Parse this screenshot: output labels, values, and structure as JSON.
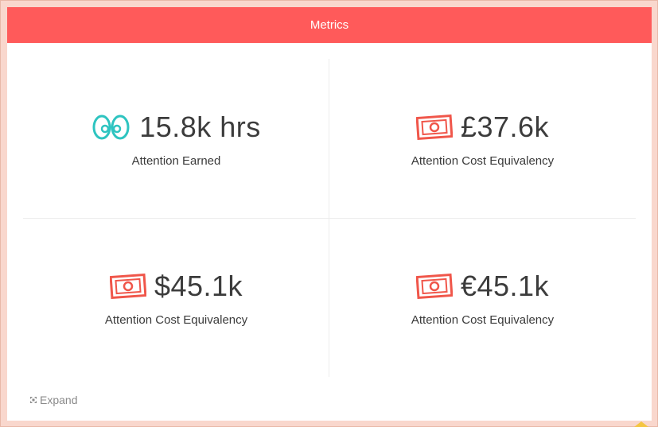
{
  "header": {
    "title": "Metrics"
  },
  "colors": {
    "accent": "#ff5a5a",
    "eyes": "#2ec4c0",
    "money": "#f0564a"
  },
  "metrics": [
    {
      "icon": "eyes-icon",
      "value": "15.8k hrs",
      "label": "Attention Earned"
    },
    {
      "icon": "money-icon",
      "value": "£37.6k",
      "label": "Attention Cost Equivalency"
    },
    {
      "icon": "money-icon",
      "value": "$45.1k",
      "label": "Attention Cost Equivalency"
    },
    {
      "icon": "money-icon",
      "value": "€45.1k",
      "label": "Attention Cost Equivalency"
    }
  ],
  "footer": {
    "expand_label": "Expand",
    "expand_icon": "expand-icon"
  }
}
